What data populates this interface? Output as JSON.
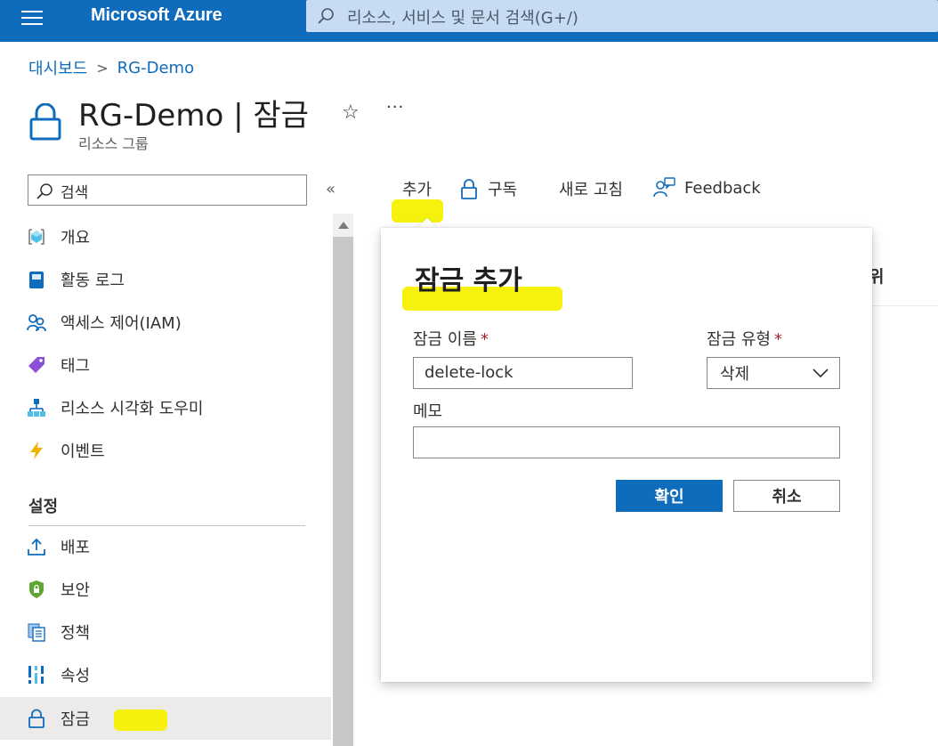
{
  "topbar": {
    "brand": "Microsoft Azure",
    "search_placeholder": "리소스, 서비스 및 문서 검색(G+/)"
  },
  "breadcrumb": {
    "items": [
      "대시보드",
      "RG-Demo"
    ]
  },
  "header": {
    "title": "RG-Demo | 잠금",
    "subtitle": "리소스 그룹"
  },
  "sidebar": {
    "search_placeholder": "검색",
    "collapse_glyph": "«",
    "items": [
      {
        "label": "개요",
        "icon": "resource-group-icon"
      },
      {
        "label": "활동 로그",
        "icon": "activity-log-icon"
      },
      {
        "label": "액세스 제어(IAM)",
        "icon": "people-icon"
      },
      {
        "label": "태그",
        "icon": "tag-icon"
      },
      {
        "label": "리소스 시각화 도우미",
        "icon": "hierarchy-icon"
      },
      {
        "label": "이벤트",
        "icon": "lightning-icon"
      }
    ],
    "section_title": "설정",
    "settings_items": [
      {
        "label": "배포",
        "icon": "upload-icon"
      },
      {
        "label": "보안",
        "icon": "shield-icon"
      },
      {
        "label": "정책",
        "icon": "policy-icon"
      },
      {
        "label": "속성",
        "icon": "properties-icon"
      },
      {
        "label": "잠금",
        "icon": "lock-icon",
        "selected": true
      }
    ]
  },
  "commandbar": {
    "add": "추가",
    "subscription": "구독",
    "refresh": "새로 고침",
    "feedback": "Feedback"
  },
  "table": {
    "partial_header": "위"
  },
  "dialog": {
    "title": "잠금 추가",
    "lock_name_label": "잠금 이름",
    "lock_name_value": "delete-lock",
    "lock_type_label": "잠금 유형",
    "lock_type_value": "삭제",
    "required_mark": "*",
    "memo_label": "메모",
    "memo_value": "",
    "ok_button": "확인",
    "cancel_button": "취소"
  },
  "colors": {
    "accent": "#0f6cbd",
    "highlight": "#f5f000",
    "required": "#a4262c"
  }
}
